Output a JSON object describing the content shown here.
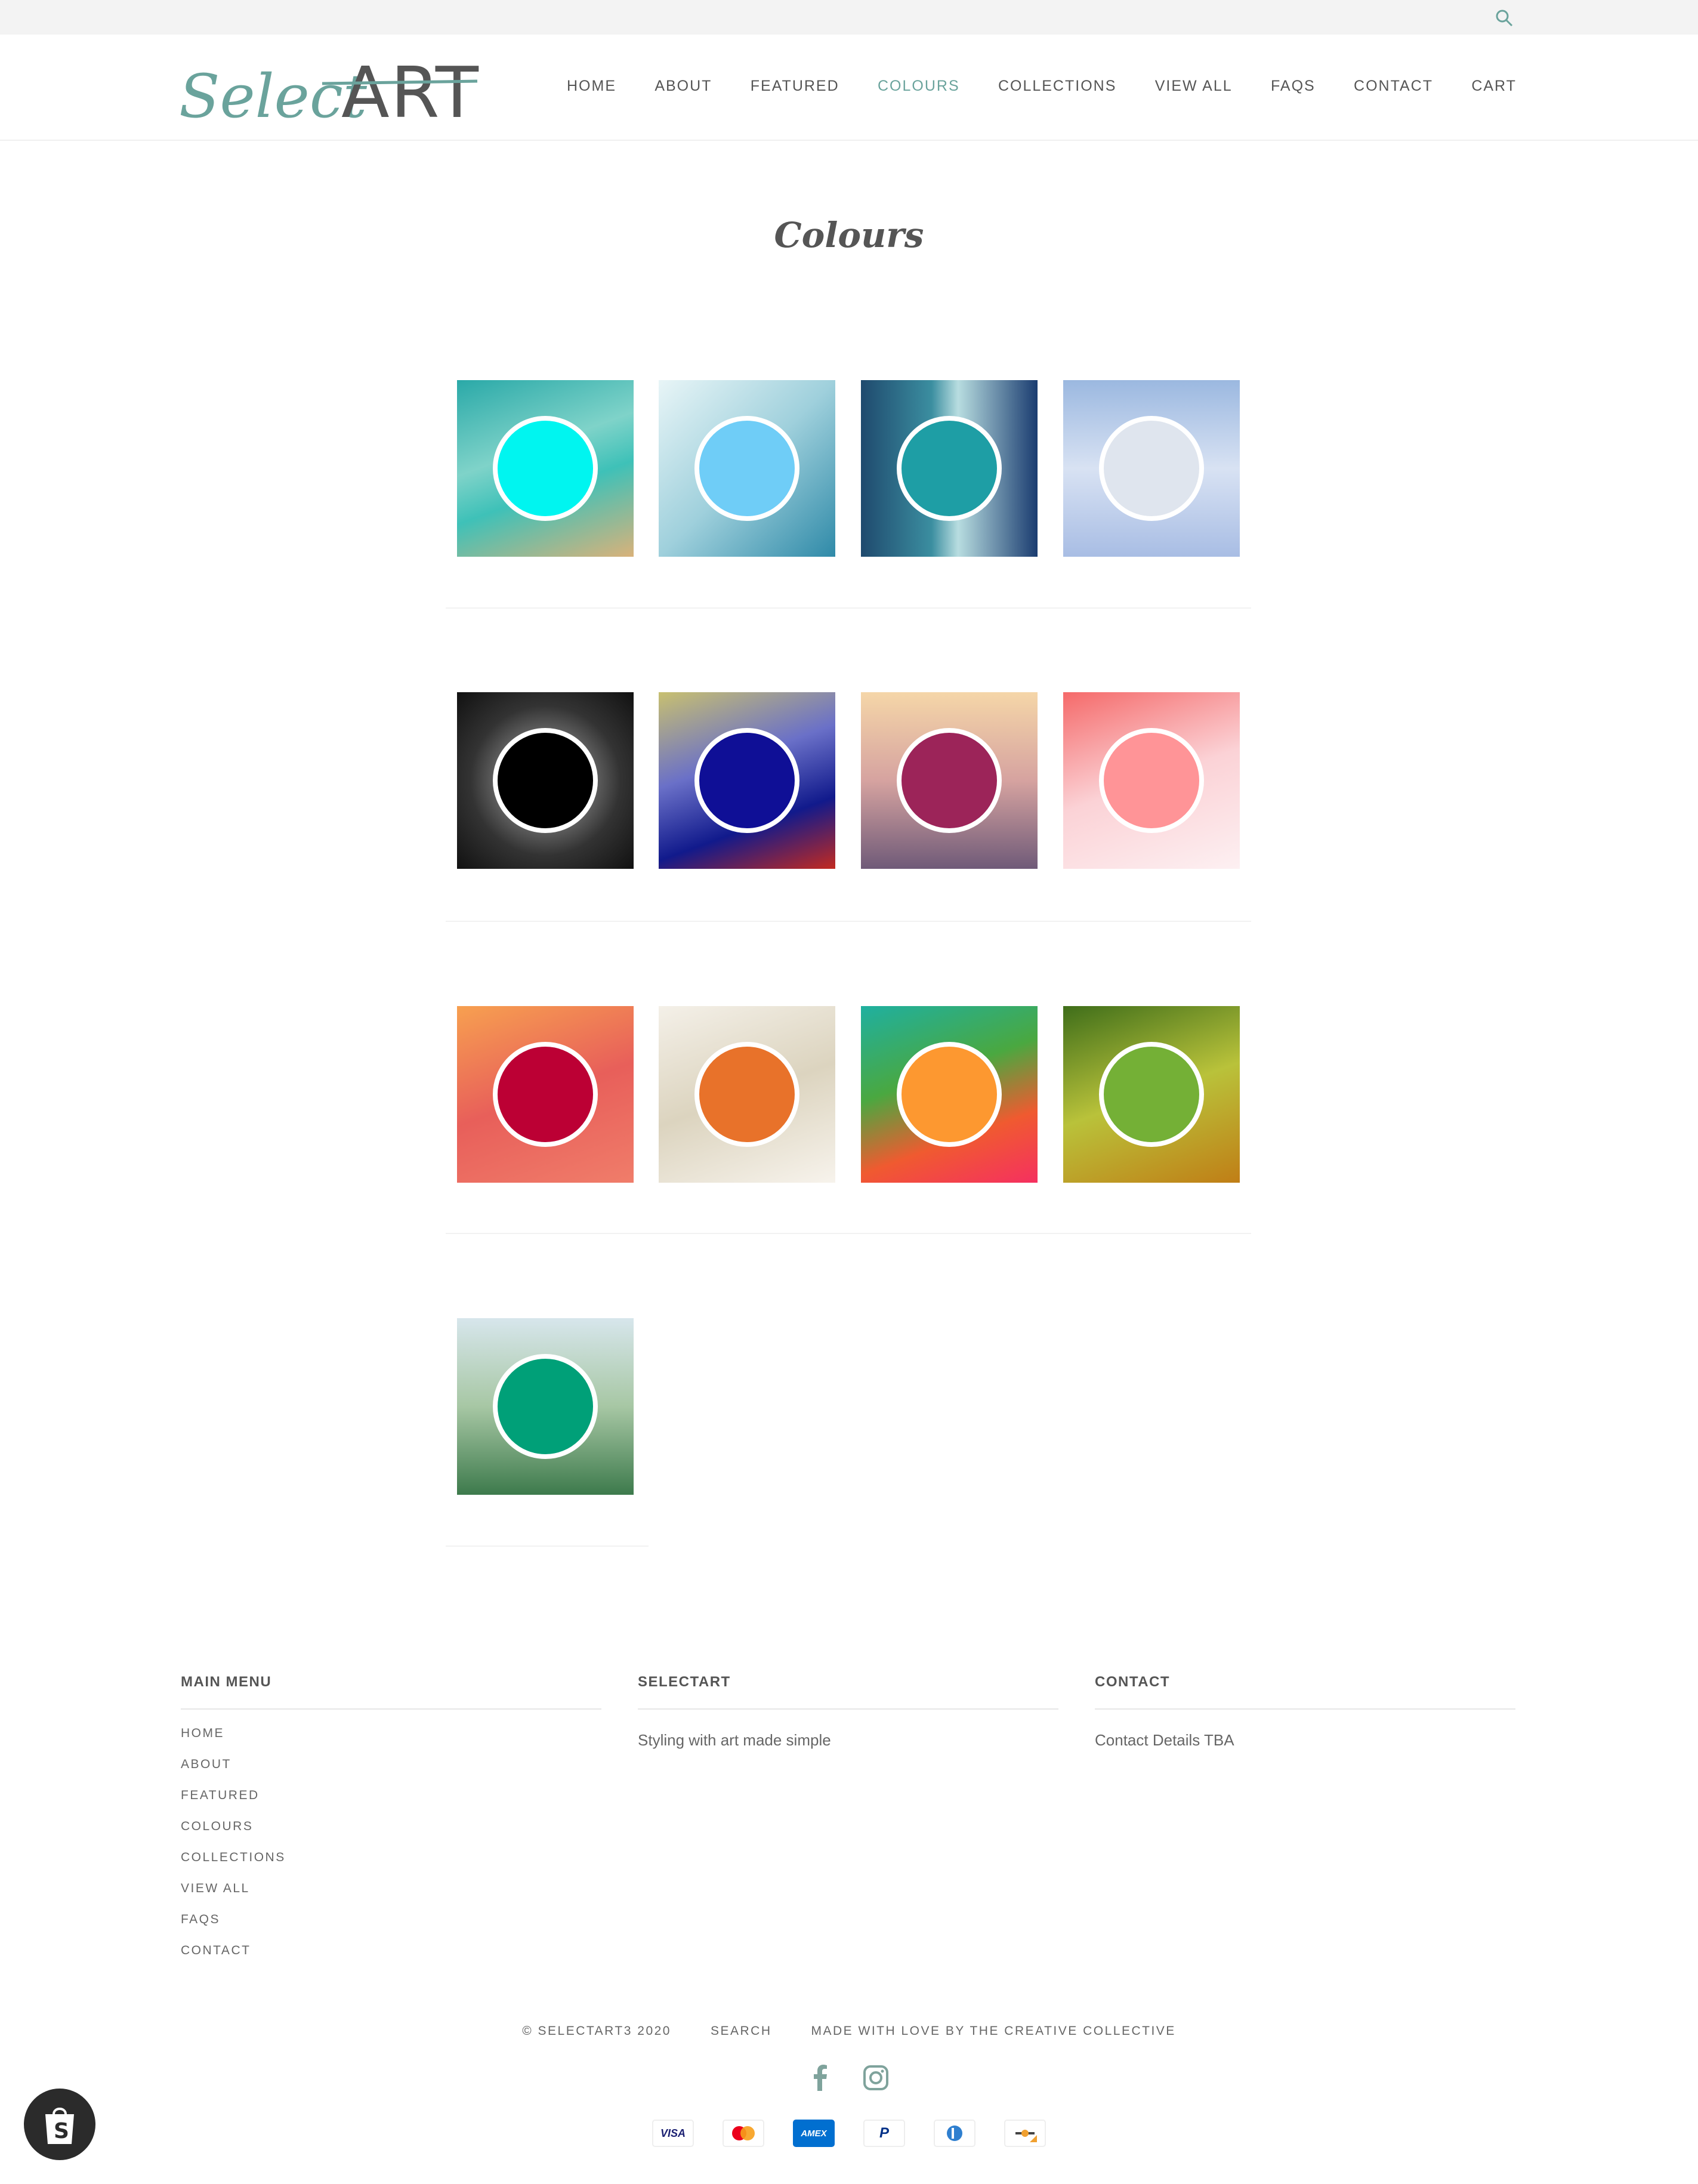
{
  "header": {
    "logo_script": "Select",
    "logo_caps": "ART",
    "nav": [
      {
        "label": "HOME"
      },
      {
        "label": "ABOUT"
      },
      {
        "label": "FEATURED"
      },
      {
        "label": "COLOURS",
        "active": true
      },
      {
        "label": "COLLECTIONS"
      },
      {
        "label": "VIEW ALL"
      },
      {
        "label": "FAQS"
      },
      {
        "label": "CONTACT"
      },
      {
        "label": "CART"
      }
    ]
  },
  "page": {
    "title": "Colours"
  },
  "swatches": [
    {
      "color": "#00f5f0",
      "bg": "linear-gradient(160deg,#2aa9a8,#7fd3c9 40%,#3ec1b8 60%,#d9b27a)"
    },
    {
      "color": "#6fcdf7",
      "bg": "linear-gradient(135deg,#e8f5f7,#9fd0dc 50%,#2f8aa8)"
    },
    {
      "color": "#1e9ea5",
      "bg": "linear-gradient(90deg,#1f4a6e,#3b8ea0 40%,#b8dde0 55%,#1a3c70)"
    },
    {
      "color": "#dfe5ee",
      "bg": "linear-gradient(180deg,#9bb8e0,#d8e2f3 50%,#a8bde4)"
    },
    {
      "color": "#000000",
      "bg": "radial-gradient(circle,#bbb,#333 60%,#111)"
    },
    {
      "color": "#0f0f96",
      "bg": "linear-gradient(160deg,#c8c070,#6a70c8 40%,#111a8c 70%,#c32a20)"
    },
    {
      "color": "#9c2459",
      "bg": "linear-gradient(180deg,#f5d6a8,#d6a3a0 50%,#6f5a78)"
    },
    {
      "color": "#ff9497",
      "bg": "linear-gradient(160deg,#f56a6a,#fbd2d6 50%,#fdf0f2)"
    },
    {
      "color": "#bc0034",
      "bg": "linear-gradient(160deg,#f7a050,#e85f5a 50%,#f07d6a)"
    },
    {
      "color": "#e8722a",
      "bg": "linear-gradient(160deg,#f4f0e8,#dcd4bf 50%,#f7f3ec)"
    },
    {
      "color": "#fd9830",
      "bg": "linear-gradient(160deg,#1fb0a0,#4aa840 40%,#f05a30 70%,#f53060)"
    },
    {
      "color": "#74b036",
      "bg": "linear-gradient(160deg,#3f6e1a,#b9c23a 50%,#c07e16)"
    },
    {
      "color": "#00a078",
      "bg": "linear-gradient(180deg,#d7e6ec,#a7c7a4 50%,#3d7a4c)"
    }
  ],
  "footer": {
    "menu": {
      "heading": "MAIN MENU",
      "items": [
        "HOME",
        "ABOUT",
        "FEATURED",
        "COLOURS",
        "COLLECTIONS",
        "VIEW ALL",
        "FAQS",
        "CONTACT"
      ]
    },
    "about": {
      "heading": "SELECTART",
      "text": "Styling with art made simple"
    },
    "contact": {
      "heading": "CONTACT",
      "text": "Contact Details TBA"
    },
    "copyright": "© SELECTART3 2020",
    "search": "SEARCH",
    "credit": "MADE WITH LOVE BY THE CREATIVE COLLECTIVE",
    "payments": {
      "visa": "VISA",
      "amex": "AMEX"
    }
  },
  "colors": {
    "accent": "#6aa39c",
    "text": "#555555"
  }
}
